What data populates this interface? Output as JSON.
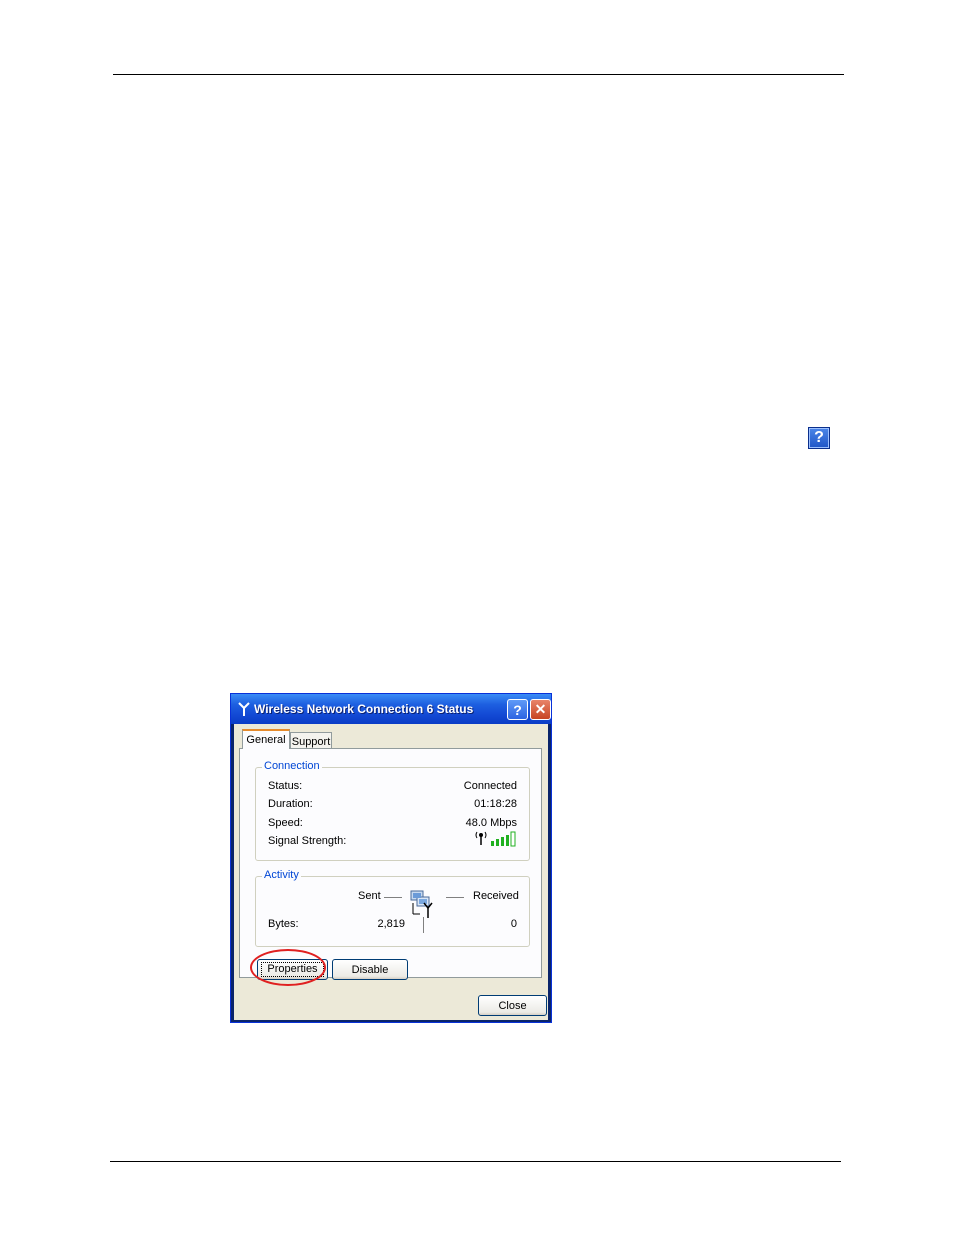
{
  "window": {
    "title": "Wireless Network Connection 6 Status",
    "help_button_label": "?",
    "close_button_label": "✕"
  },
  "page": {
    "help_badge_label": "?"
  },
  "tabs": [
    {
      "label": "General"
    },
    {
      "label": "Support"
    }
  ],
  "connection": {
    "group_label": "Connection",
    "status_label": "Status:",
    "status_value": "Connected",
    "duration_label": "Duration:",
    "duration_value": "01:18:28",
    "speed_label": "Speed:",
    "speed_value": "48.0 Mbps",
    "signal_label": "Signal Strength:",
    "signal_bars": 5
  },
  "activity": {
    "group_label": "Activity",
    "sent_label": "Sent",
    "received_label": "Received",
    "bytes_label": "Bytes:",
    "bytes_sent": "2,819",
    "bytes_received": "0"
  },
  "buttons": {
    "properties": "Properties",
    "disable": "Disable",
    "close": "Close"
  },
  "colors": {
    "titlebar": "#1d5fe0",
    "group_label": "#0046d5",
    "highlight": "#e02020",
    "signal": "#20b020"
  }
}
